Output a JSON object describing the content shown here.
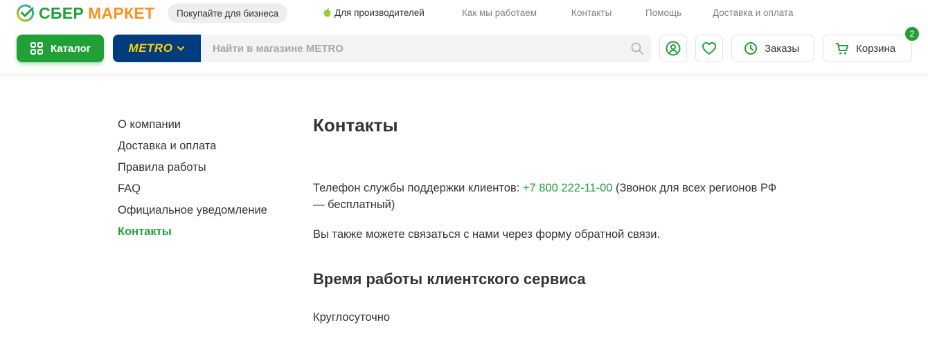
{
  "brand": {
    "sber": "СБЕР",
    "market": "МАРКЕТ",
    "green": "#21a038",
    "orange": "#f7931e"
  },
  "topbar": {
    "business_pill": "Покупайте для бизнеса",
    "links": [
      "Для производителей",
      "Как мы работаем",
      "Контакты",
      "Помощь",
      "Доставка и оплата"
    ]
  },
  "header": {
    "catalog_label": "Каталог",
    "store_name": "METRO",
    "store_color": "#003c7e",
    "search_placeholder": "Найти в магазине METRO",
    "orders_label": "Заказы",
    "cart_label": "Корзина",
    "cart_count": "2"
  },
  "sidebar": {
    "items": [
      "О компании",
      "Доставка и оплата",
      "Правила работы",
      "FAQ",
      "Официальное уведомление",
      "Контакты"
    ],
    "active_index": 5
  },
  "content": {
    "title": "Контакты",
    "support_prefix": "Телефон службы поддержки клиентов: ",
    "support_phone": "+7 800 222-11-00",
    "support_suffix": " (Звонок для всех регионов РФ — бесплатный)",
    "feedback_text": "Вы также можете связаться с нами через форму обратной связи.",
    "hours_title": "Время работы клиентского сервиса",
    "hours_value": "Круглосуточно"
  }
}
